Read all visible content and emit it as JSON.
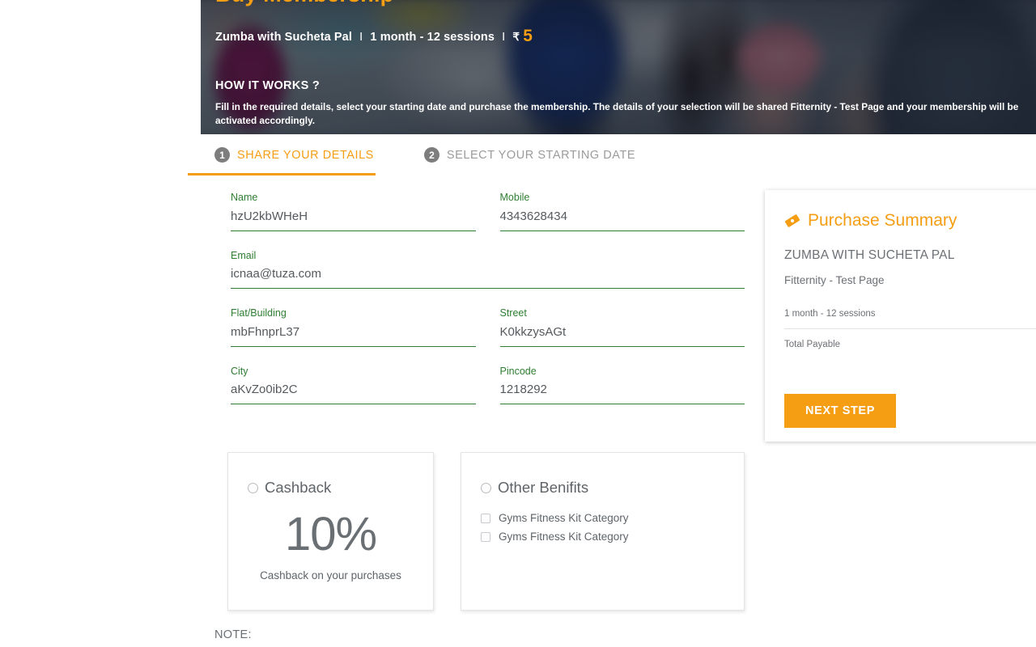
{
  "hero": {
    "top_title_partial": "Buy Membership",
    "pack_name": "Zumba with Sucheta Pal",
    "separator": "I",
    "plan": "1 month - 12 sessions",
    "currency": "₹",
    "price": "5",
    "how_it_works_heading": "HOW IT WORKS ?",
    "description": "Fill in the required details, select your starting date and purchase the membership. The details of your selection will be shared Fitternity - Test Page and your membership will be activated accordingly."
  },
  "tabs": [
    {
      "num": "1",
      "label": "SHARE YOUR DETAILS",
      "active": true
    },
    {
      "num": "2",
      "label": "SELECT YOUR STARTING DATE",
      "active": false
    }
  ],
  "form": {
    "fields": [
      {
        "label": "Name",
        "value": "hzU2kbWHeH",
        "placeholder": "Name"
      },
      {
        "label": "Mobile",
        "value": "4343628434",
        "placeholder": "Mobile"
      },
      {
        "label": "Email",
        "value": "icnaa@tuza.com",
        "placeholder": "Email"
      },
      {
        "label": "Flat/Building",
        "value": "mbFhnprL37",
        "placeholder": "Flat/Building"
      },
      {
        "label": "Street",
        "value": "K0kkzysAGt",
        "placeholder": "Street"
      },
      {
        "label": "City",
        "value": "aKvZo0ib2C",
        "placeholder": "City"
      },
      {
        "label": "Pincode",
        "value": "1218292",
        "placeholder": "Pincode"
      }
    ]
  },
  "summary": {
    "title": "Purchase Summary",
    "icon": "ticket-icon",
    "pack_name": "ZUMBA WITH SUCHETA PAL",
    "vendor": "Fitternity - Test Page",
    "plan": "1 month - 12 sessions",
    "total_label": "Total Payable",
    "total_value": "",
    "next_step_label": "NEXT STEP"
  },
  "benefit_cards": {
    "cashback": {
      "option_label": "Cashback",
      "selected": false,
      "percent": "10%",
      "caption": "Cashback on your purchases"
    },
    "other": {
      "option_label": "Other Benifits",
      "selected": false,
      "items": [
        {
          "label": "Gyms Fitness Kit Category",
          "checked": false
        },
        {
          "label": "Gyms Fitness Kit Category",
          "checked": false
        }
      ]
    }
  },
  "note": {
    "label": "NOTE:"
  },
  "colors": {
    "accent_orange": "#f59d13",
    "field_green": "#2e7d32",
    "text_grey": "#6a6f73",
    "inactive_grey": "#9b9b9b"
  }
}
